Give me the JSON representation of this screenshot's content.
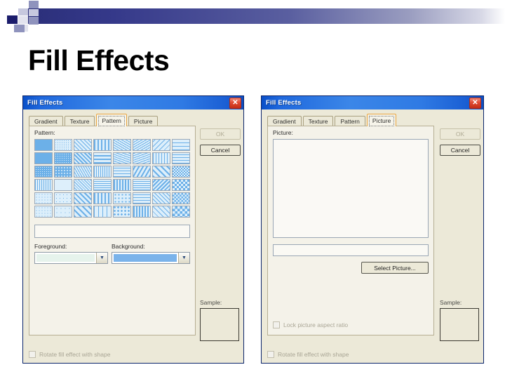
{
  "slide": {
    "title": "Fill Effects",
    "decor": {
      "dark": "#1b1c6b",
      "mid": "#8f93bd",
      "light": "#c6c8de",
      "gradient_start": "#2b2f7a"
    }
  },
  "dialog_left": {
    "title": "Fill Effects",
    "close_icon": "close-icon",
    "close_glyph": "✕",
    "tabs": [
      {
        "label": "Gradient",
        "active": false
      },
      {
        "label": "Texture",
        "active": false
      },
      {
        "label": "Pattern",
        "active": true
      },
      {
        "label": "Picture",
        "active": false
      }
    ],
    "pattern_label": "Pattern:",
    "pattern_name": "",
    "foreground_label": "Foreground:",
    "background_label": "Background:",
    "foreground_color": "#e6f3ec",
    "background_color": "#7ab3ea",
    "ok_label": "OK",
    "ok_enabled": false,
    "cancel_label": "Cancel",
    "sample_label": "Sample:",
    "rotate_label": "Rotate fill effect with shape",
    "rotate_checked": false,
    "pattern_grid": {
      "columns": 8,
      "rows": 6,
      "fg": "#6cb0e8",
      "bg": "#ddeffb",
      "swatches": [
        "5% dots",
        "10% dots",
        "20% dots",
        "vertical narrow",
        "wide upward diagonal",
        "light upward diagonal",
        "light downward diagonal",
        "large grid",
        "25% dots",
        "30% dots",
        "40% dots",
        "horizontal wide",
        "dashed upward diagonal",
        "dashed downward diagonal",
        "narrow vertical dash",
        "small grid",
        "50% dots",
        "60% dots",
        "70% dots",
        "vertical dense",
        "dashed horizontal",
        "wide downward diagonal",
        "light vertical",
        "checker small",
        "75% dots",
        "80% dots",
        "90% dots",
        "horizontal narrow",
        "zig zag",
        "horizontal brick",
        "diagonal brick",
        "checkerboard",
        "dotted diamond",
        "dotted grid",
        "diagonal stripe",
        "vertical stripe",
        "shingle",
        "plaid",
        "weave",
        "large checker",
        "small confetti",
        "large confetti",
        "wide diagonal",
        "narrow diagonal",
        "sphere",
        "divot",
        "trellis",
        "outlined diamond"
      ]
    }
  },
  "dialog_right": {
    "title": "Fill Effects",
    "close_icon": "close-icon",
    "close_glyph": "✕",
    "tabs": [
      {
        "label": "Gradient",
        "active": false
      },
      {
        "label": "Texture",
        "active": false
      },
      {
        "label": "Pattern",
        "active": false
      },
      {
        "label": "Picture",
        "active": true
      }
    ],
    "picture_label": "Picture:",
    "picture_path": "",
    "select_picture_label": "Select Picture...",
    "lock_aspect_label": "Lock picture aspect ratio",
    "lock_aspect_checked": false,
    "ok_label": "OK",
    "ok_enabled": false,
    "cancel_label": "Cancel",
    "sample_label": "Sample:",
    "rotate_label": "Rotate fill effect with shape",
    "rotate_checked": false
  }
}
